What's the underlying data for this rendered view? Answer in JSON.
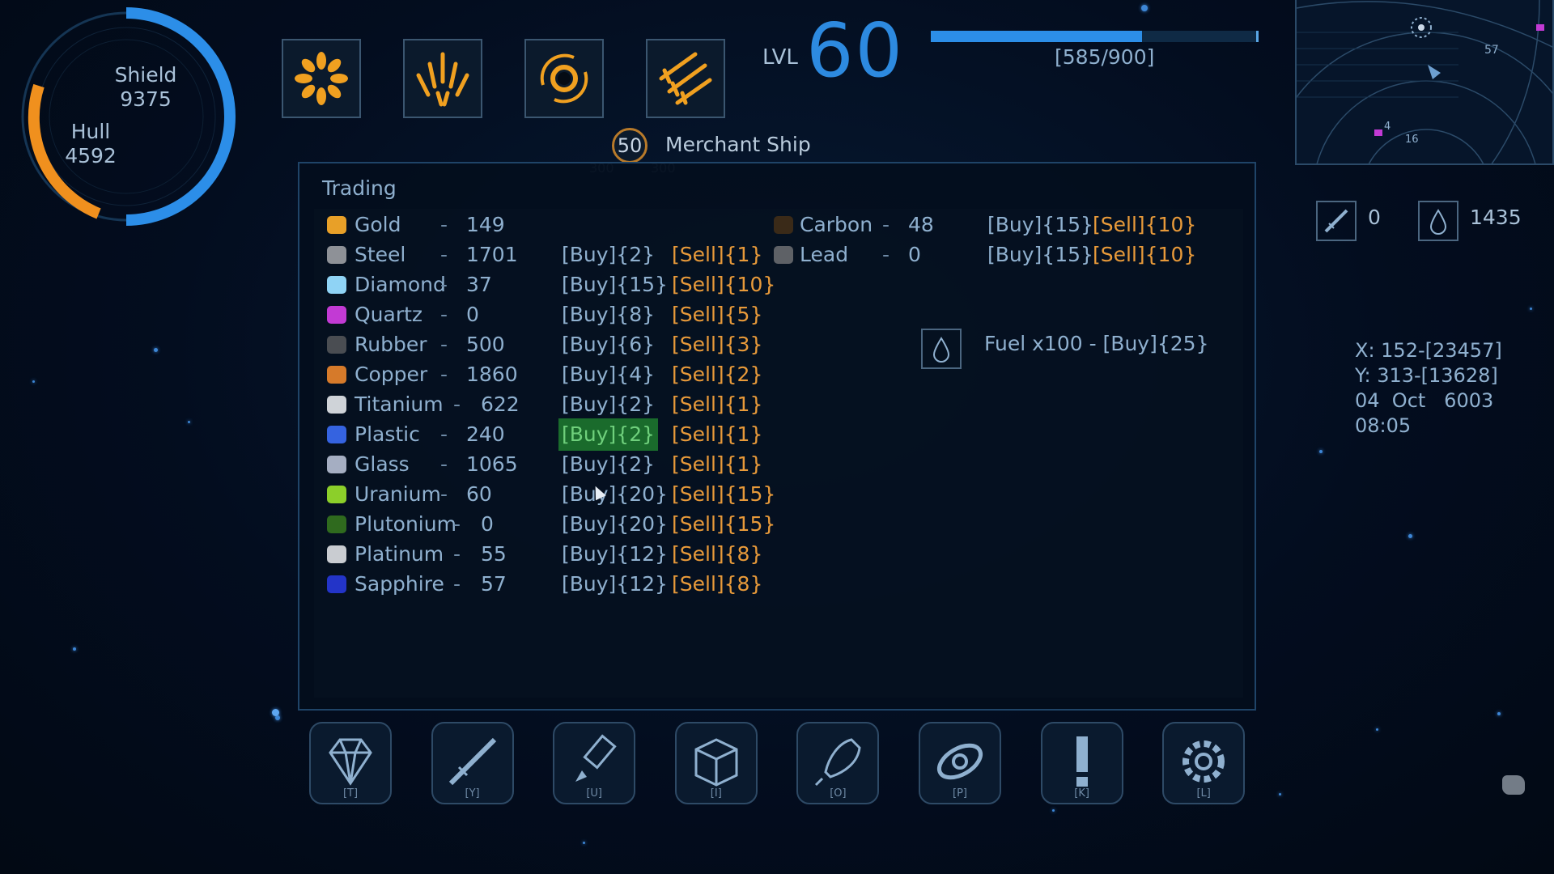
{
  "hud": {
    "shield_label": "Shield",
    "shield_value": "9375",
    "hull_label": "Hull",
    "hull_value": "4592",
    "level_label": "LVL",
    "level_value": "60",
    "xp_text": "[585/900]",
    "xp_fraction": 0.65,
    "colors": {
      "shield": "#2c8ee8",
      "hull": "#f0901e",
      "accent": "#e89a3a"
    }
  },
  "abilities": [
    {
      "icon": "burst-icon"
    },
    {
      "icon": "scatter-shot-icon"
    },
    {
      "icon": "vortex-icon"
    },
    {
      "icon": "missile-barrage-icon"
    }
  ],
  "target": {
    "level": "50",
    "name": "Merchant Ship",
    "faint_left": "300",
    "faint_right": "300"
  },
  "trading": {
    "title": "Trading",
    "left_items": [
      {
        "name": "Gold",
        "qty": "149",
        "color": "#e8a028"
      },
      {
        "name": "Steel",
        "qty": "1701",
        "buy": "[Buy]{2}",
        "sell": "[Sell]{1}",
        "color": "#8e9197"
      },
      {
        "name": "Diamond",
        "qty": "37",
        "buy": "[Buy]{15}",
        "sell": "[Sell]{10}",
        "color": "#8fd3f5"
      },
      {
        "name": "Quartz",
        "qty": "0",
        "buy": "[Buy]{8}",
        "sell": "[Sell]{5}",
        "color": "#c23ad4"
      },
      {
        "name": "Rubber",
        "qty": "500",
        "buy": "[Buy]{6}",
        "sell": "[Sell]{3}",
        "color": "#4a4d52"
      },
      {
        "name": "Copper",
        "qty": "1860",
        "buy": "[Buy]{4}",
        "sell": "[Sell]{2}",
        "color": "#d67a2a"
      },
      {
        "name": "Titanium",
        "qty": "622",
        "buy": "[Buy]{2}",
        "sell": "[Sell]{1}",
        "color": "#cfd3d8"
      },
      {
        "name": "Plastic",
        "qty": "240",
        "buy": "[Buy]{2}",
        "sell": "[Sell]{1}",
        "color": "#3563e0"
      },
      {
        "name": "Glass",
        "qty": "1065",
        "buy": "[Buy]{2}",
        "sell": "[Sell]{1}",
        "color": "#a5aec2"
      },
      {
        "name": "Uranium",
        "qty": "60",
        "buy": "[Buy]{20}",
        "sell": "[Sell]{15}",
        "color": "#8ccf2a"
      },
      {
        "name": "Plutonium",
        "qty": "0",
        "buy": "[Buy]{20}",
        "sell": "[Sell]{15}",
        "color": "#2f6a1e"
      },
      {
        "name": "Platinum",
        "qty": "55",
        "buy": "[Buy]{12}",
        "sell": "[Sell]{8}",
        "color": "#c9ccd1"
      },
      {
        "name": "Sapphire",
        "qty": "57",
        "buy": "[Buy]{12}",
        "sell": "[Sell]{8}",
        "color": "#2334c8"
      }
    ],
    "right_items": [
      {
        "name": "Carbon",
        "qty": "48",
        "buy": "[Buy]{15}",
        "sell": "[Sell]{10}",
        "color": "#3a2a18"
      },
      {
        "name": "Lead",
        "qty": "0",
        "buy": "[Buy]{15}",
        "sell": "[Sell]{10}",
        "color": "#5e6166"
      }
    ],
    "fuel_offer": "Fuel x100 - [Buy]{25}"
  },
  "status": {
    "missiles": "0",
    "fuel": "1435"
  },
  "coords": {
    "x": "X: 152-[23457]",
    "y": "Y: 313-[13628]",
    "date": "04  Oct   6003",
    "time": "08:05"
  },
  "minimap": {
    "label_a": "57",
    "label_b": "4",
    "label_c": "16"
  },
  "bottom_bar": [
    {
      "name": "gems-button",
      "icon": "diamond-icon",
      "key": "[T]"
    },
    {
      "name": "weapons-button",
      "icon": "rifle-icon",
      "key": "[Y]"
    },
    {
      "name": "upgrades-button",
      "icon": "thruster-icon",
      "key": "[U]"
    },
    {
      "name": "cargo-button",
      "icon": "crate-icon",
      "key": "[I]"
    },
    {
      "name": "ships-button",
      "icon": "rocket-icon",
      "key": "[O]"
    },
    {
      "name": "galaxy-button",
      "icon": "galaxy-icon",
      "key": "[P]"
    },
    {
      "name": "quests-button",
      "icon": "exclamation-icon",
      "key": "[K]"
    },
    {
      "name": "settings-button",
      "icon": "gear-icon",
      "key": "[L]"
    }
  ]
}
